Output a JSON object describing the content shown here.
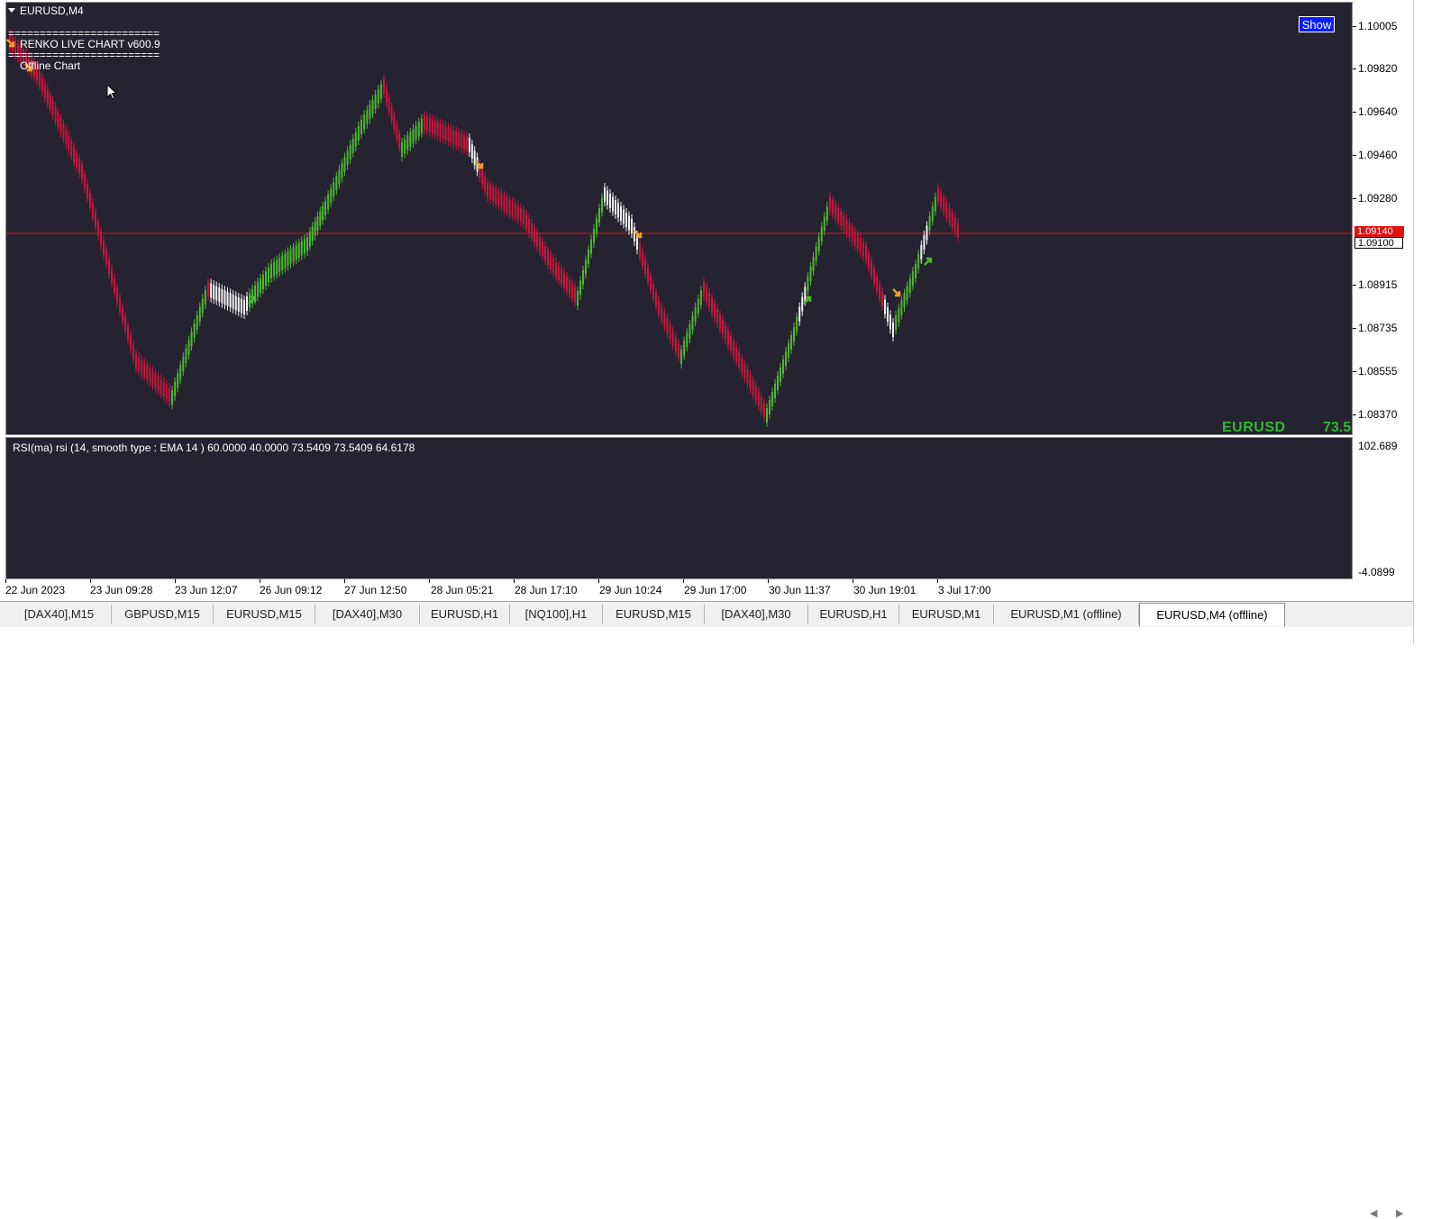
{
  "window": {
    "title": "EURUSD,M4",
    "overlay_lines": [
      "========================",
      "RENKO LIVE CHART v600.9",
      "========================",
      "Offline Chart"
    ],
    "show_button_label": "Show"
  },
  "price_axis": {
    "labels": [
      "1.10005",
      "1.09820",
      "1.09640",
      "1.09460",
      "1.09280",
      "1.08915",
      "1.08735",
      "1.08555",
      "1.08370"
    ],
    "current_price_tag": "1.09140",
    "bid_tag": "1.09100"
  },
  "symbol_readout": {
    "symbol": "EURUSD",
    "value": "73.5"
  },
  "rsi_panel": {
    "title": "RSI(ma) rsi (14, smooth type : EMA  14 ) 60.0000 40.0000 73.5409 73.5409 64.6178",
    "scale_top": "102.689",
    "scale_bottom": "-4.0899"
  },
  "time_axis": {
    "labels": [
      "22 Jun 2023",
      "23 Jun 09:28",
      "23 Jun 12:07",
      "26 Jun 09:12",
      "27 Jun 12:50",
      "28 Jun 05:21",
      "28 Jun 17:10",
      "29 Jun 10:24",
      "29 Jun 17:00",
      "30 Jun 11:37",
      "30 Jun 19:01",
      "3 Jul 17:00"
    ]
  },
  "tabs": [
    {
      "label": "[DAX40],M15",
      "active": false
    },
    {
      "label": "GBPUSD,M15",
      "active": false
    },
    {
      "label": "EURUSD,M15",
      "active": false
    },
    {
      "label": "[DAX40],M30",
      "active": false
    },
    {
      "label": "EURUSD,H1",
      "active": false
    },
    {
      "label": "[NQ100],H1",
      "active": false
    },
    {
      "label": "EURUSD,M15",
      "active": false
    },
    {
      "label": "[DAX40],M30",
      "active": false
    },
    {
      "label": "EURUSD,H1",
      "active": false
    },
    {
      "label": "EURUSD,M1",
      "active": false
    },
    {
      "label": "EURUSD,M1 (offline)",
      "active": false
    },
    {
      "label": "EURUSD,M4 (offline)",
      "active": true
    }
  ],
  "colors": {
    "background": "#262330",
    "bull_brick": "#4cb82e",
    "bear_brick": "#c8143c",
    "neutral_brick": "#f0f0f0",
    "rsi_up": "#22e07a",
    "rsi_down": "#d8143c",
    "rsi_neutral": "#c8c8c8",
    "price_line": "#e01010",
    "signal_arrow": "#f0a020"
  },
  "icons": {
    "tab_scroll_left": "chevron-left-icon",
    "tab_scroll_right": "chevron-right-icon",
    "collapse": "triangle-down-icon"
  }
}
